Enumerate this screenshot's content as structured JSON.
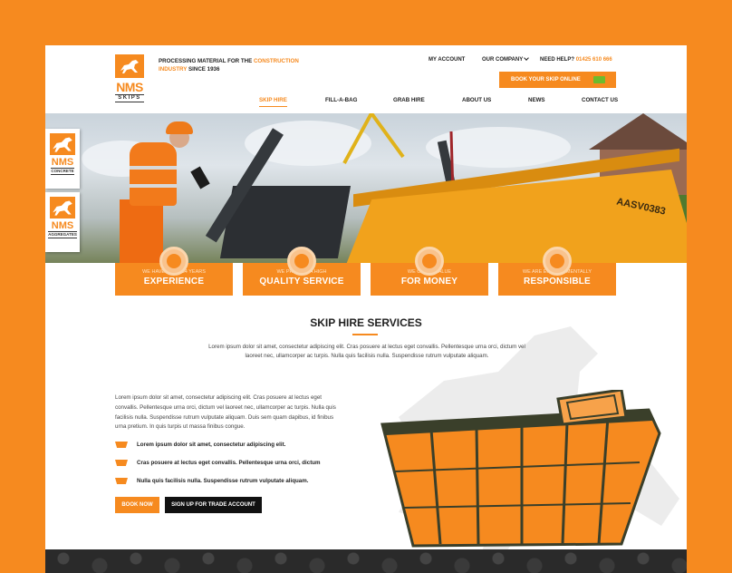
{
  "header": {
    "logo": {
      "main": "NMS",
      "sub": "SKIPS"
    },
    "tagline": {
      "part1": "PROCESSING MATERIAL FOR THE ",
      "highlight": "CONSTRUCTION INDUSTRY",
      "part2": " SINCE 1936"
    },
    "my_account": "MY ACCOUNT",
    "our_company": "OUR COMPANY",
    "need_help": "NEED HELP?",
    "phone": "01425 610 666",
    "book_button": "BOOK YOUR SKIP ONLINE"
  },
  "nav": [
    {
      "label": "SKIP HIRE",
      "active": true
    },
    {
      "label": "FILL-A-BAG",
      "active": false
    },
    {
      "label": "GRAB HIRE",
      "active": false
    },
    {
      "label": "ABOUT US",
      "active": false
    },
    {
      "label": "NEWS",
      "active": false
    },
    {
      "label": "CONTACT US",
      "active": false
    }
  ],
  "side_tabs": [
    {
      "main": "NMS",
      "sub": "CONCRETE"
    },
    {
      "main": "NMS",
      "sub": "AGGREGATES"
    }
  ],
  "hero": {
    "skip_text": "AASV0383"
  },
  "features": [
    {
      "small": "WE HAVE OVER 84 YEARS",
      "big": "EXPERIENCE",
      "icon": "helmet-icon"
    },
    {
      "small": "WE PROVIDE A HIGH",
      "big": "QUALITY SERVICE",
      "icon": "quality-check-icon"
    },
    {
      "small": "WE OFFER VALUE",
      "big": "FOR MONEY",
      "icon": "money-hand-icon"
    },
    {
      "small": "WE ARE ENVIRONMENTALLY",
      "big": "RESPONSIBLE",
      "icon": "leaf-icon"
    }
  ],
  "services": {
    "title": "SKIP HIRE SERVICES",
    "intro": "Lorem ipsum dolor sit amet, consectetur adipiscing elit. Cras posuere at lectus eget convallis. Pellentesque urna orci, dictum vel laoreet nec, ullamcorper ac turpis. Nulla quis facilisis nulla. Suspendisse rutrum vulputate aliquam.",
    "body": "Lorem ipsum dolor sit amet, consectetur adipiscing elit. Cras posuere at lectus eget convallis. Pellentesque urna orci, dictum vel laoreet nec, ullamcorper ac turpis. Nulla quis facilisis nulla. Suspendisse rutrum vulputate aliquam. Duis sem quam dapibus, id finibus urna pretium. In quis turpis ut massa finibus congue.",
    "bullets": [
      "Lorem ipsum dolor sit amet, consectetur adipiscing elit.",
      "Cras posuere at lectus eget convallis. Pellentesque urna orci, dictum",
      "Nulla quis facilisis nulla. Suspendisse rutrum vulputate aliquam."
    ],
    "book_now": "BOOK NOW",
    "trade_account": "SIGN UP FOR TRADE ACCOUNT"
  },
  "colors": {
    "accent": "#f68a1f",
    "dark": "#111111",
    "eco": "#6dbb2c"
  }
}
